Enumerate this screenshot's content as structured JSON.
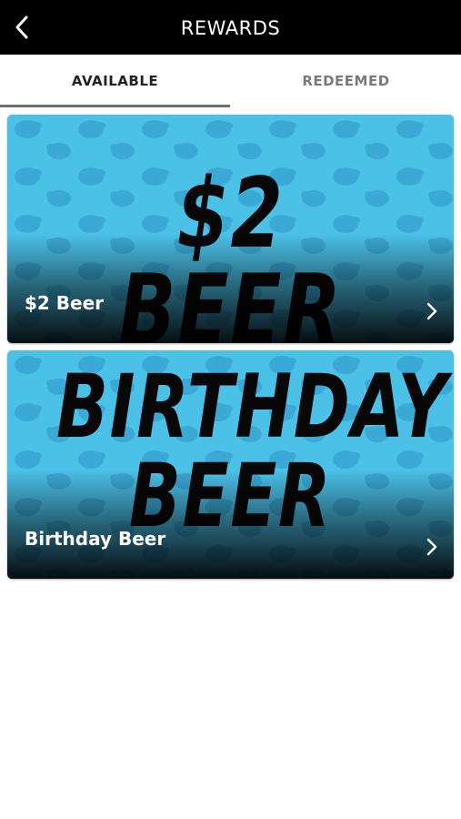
{
  "header": {
    "title": "REWARDS",
    "back_icon": "chevron-left-icon"
  },
  "tabs": [
    {
      "label": "AVAILABLE",
      "active": true
    },
    {
      "label": "REDEEMED",
      "active": false
    }
  ],
  "rewards": [
    {
      "label": "$2 Beer",
      "image_text": [
        "$2 BEER"
      ],
      "chevron_icon": "chevron-right-icon"
    },
    {
      "label": "Birthday Beer",
      "image_text": [
        "BIRTHDAY",
        "BEER"
      ],
      "chevron_icon": "chevron-right-icon"
    }
  ],
  "colors": {
    "header_bg": "#000000",
    "card_bg": "#4bc1e8",
    "hop_pattern": "#3aa9d6",
    "tab_active_text": "#222222",
    "tab_inactive_text": "#7a7a7a",
    "tab_indicator": "#6e6e6e"
  }
}
